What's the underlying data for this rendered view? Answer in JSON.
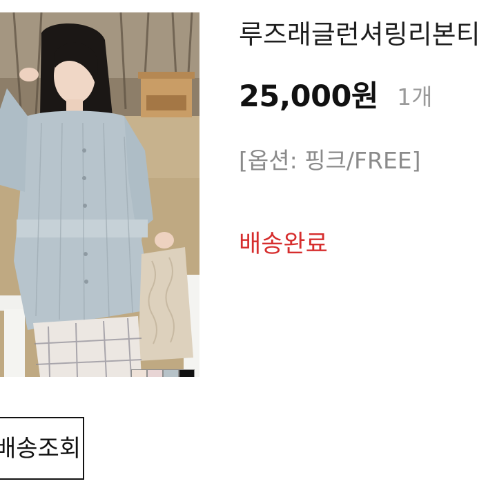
{
  "product": {
    "name": "루즈래글런셔링리본티",
    "price": "25,000원",
    "quantity": "1개",
    "option": "[옵션: 핑크/FREE]",
    "status": "배송완료",
    "swatch_colors": [
      "#efe2d8",
      "#e8d5d5",
      "#b6c2c8",
      "#111111"
    ]
  },
  "actions": {
    "track_label": "배송조회"
  },
  "colors": {
    "status": "#d62d2d",
    "price": "#111111",
    "muted": "#8a8a8a"
  }
}
